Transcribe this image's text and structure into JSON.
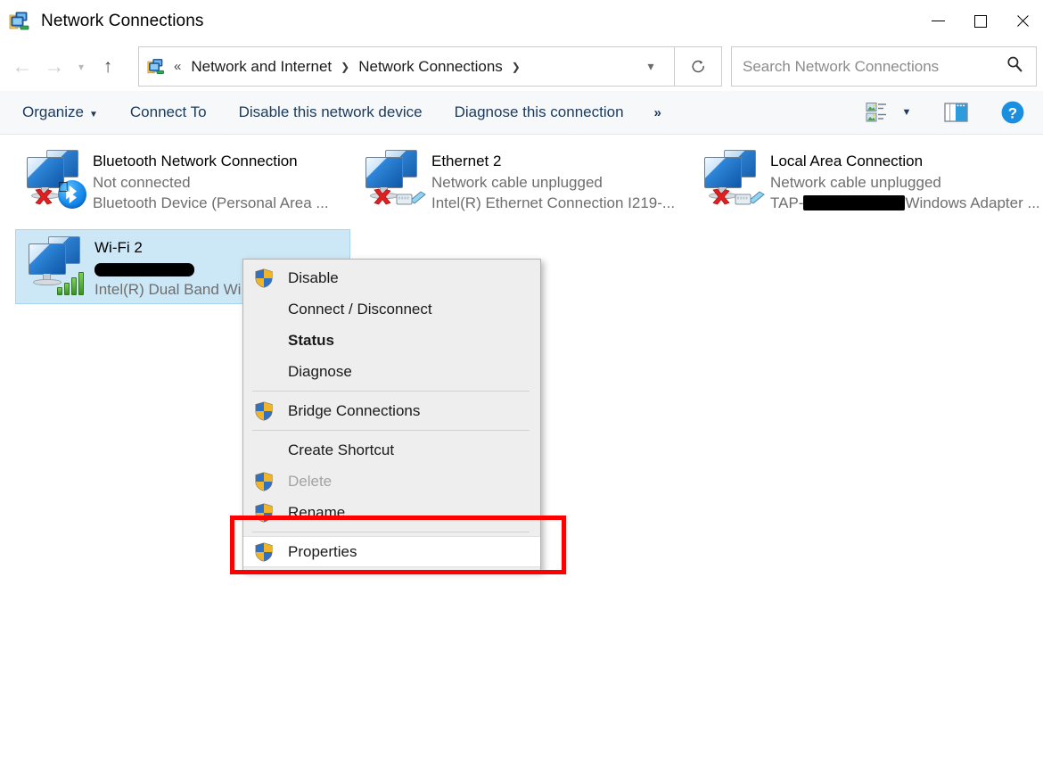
{
  "window": {
    "title": "Network Connections",
    "icon": "network-connections-icon",
    "controls": {
      "minimize": "minimize-button",
      "maximize": "maximize-button",
      "close": "close-button"
    }
  },
  "navbar": {
    "back": "back-button",
    "forward": "forward-button",
    "recent": "recent-locations-button",
    "up": "up-button",
    "breadcrumb": {
      "icon": "network-connections-icon",
      "overflow": "«",
      "items": [
        "Network and Internet",
        "Network Connections"
      ],
      "separator": "❯",
      "dropdown": "address-dropdown"
    },
    "refresh": "refresh-button"
  },
  "search": {
    "placeholder": "Search Network Connections",
    "value": "",
    "icon": "search-icon"
  },
  "commandbar": {
    "items": [
      {
        "label": "Organize",
        "has_caret": true
      },
      {
        "label": "Connect To",
        "has_caret": false
      },
      {
        "label": "Disable this network device",
        "has_caret": false
      },
      {
        "label": "Diagnose this connection",
        "has_caret": false
      }
    ],
    "overflow": "»",
    "view_icon": "change-view-icon",
    "view_caret": "⌄",
    "preview_icon": "preview-pane-icon",
    "help_icon": "help-icon"
  },
  "connections": [
    {
      "name": "Bluetooth Network Connection",
      "status": "Not connected",
      "device": "Bluetooth Device (Personal Area ...",
      "adapter_icon": "bluetooth-icon",
      "error_icon": "red-x-icon",
      "selected": false,
      "redacted": false
    },
    {
      "name": "Ethernet 2",
      "status": "Network cable unplugged",
      "device": "Intel(R) Ethernet Connection I219-...",
      "adapter_icon": "ethernet-cable-icon",
      "error_icon": "red-x-icon",
      "selected": false,
      "redacted": false
    },
    {
      "name": "Local Area Connection",
      "status": "Network cable unplugged",
      "device_prefix": "TAP-",
      "device_suffix": "Windows Adapter ...",
      "device_redacted_width": 114,
      "adapter_icon": "ethernet-cable-icon",
      "error_icon": "red-x-icon",
      "selected": false,
      "redacted": true
    },
    {
      "name": "Wi-Fi 2",
      "status_redacted_width": 112,
      "device": "Intel(R) Dual Band Wi",
      "adapter_icon": "wifi-signal-icon",
      "selected": true,
      "redacted": true
    }
  ],
  "context_menu": {
    "items": [
      {
        "label": "Disable",
        "shield": true,
        "bold": false,
        "disabled": false,
        "hovered": false,
        "separator_after": false
      },
      {
        "label": "Connect / Disconnect",
        "shield": false,
        "bold": false,
        "disabled": false,
        "hovered": false,
        "separator_after": false
      },
      {
        "label": "Status",
        "shield": false,
        "bold": true,
        "disabled": false,
        "hovered": false,
        "separator_after": false
      },
      {
        "label": "Diagnose",
        "shield": false,
        "bold": false,
        "disabled": false,
        "hovered": false,
        "separator_after": true
      },
      {
        "label": "Bridge Connections",
        "shield": true,
        "bold": false,
        "disabled": false,
        "hovered": false,
        "separator_after": true
      },
      {
        "label": "Create Shortcut",
        "shield": false,
        "bold": false,
        "disabled": false,
        "hovered": false,
        "separator_after": false
      },
      {
        "label": "Delete",
        "shield": true,
        "bold": false,
        "disabled": true,
        "hovered": false,
        "separator_after": false
      },
      {
        "label": "Rename",
        "shield": true,
        "bold": false,
        "disabled": false,
        "hovered": false,
        "separator_after": true
      },
      {
        "label": "Properties",
        "shield": true,
        "bold": false,
        "disabled": false,
        "hovered": true,
        "separator_after": false
      }
    ]
  },
  "annotation": {
    "type": "highlight-rectangle",
    "color": "#ff0000",
    "target": "Properties"
  },
  "colors": {
    "selection": "#cce8f7",
    "command_text": "#1b3a5c",
    "menu_background": "#eeeeee",
    "annotation": "#ff0000"
  }
}
